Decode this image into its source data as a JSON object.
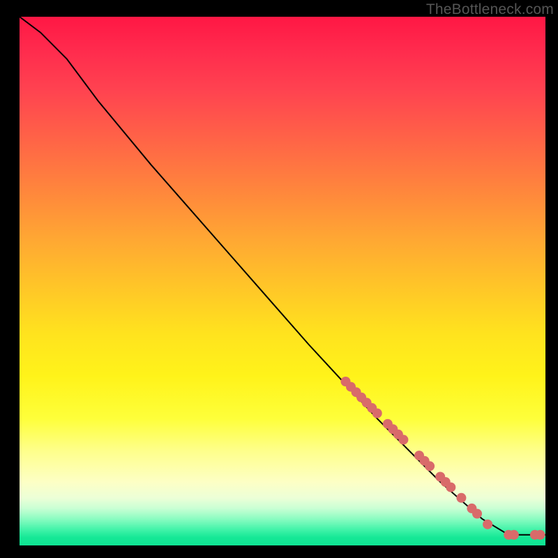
{
  "watermark": "TheBottleneck.com",
  "chart_data": {
    "type": "line",
    "title": "",
    "xlabel": "",
    "ylabel": "",
    "xlim": [
      0,
      100
    ],
    "ylim": [
      0,
      100
    ],
    "curve": [
      {
        "x": 0,
        "y": 100
      },
      {
        "x": 4,
        "y": 97
      },
      {
        "x": 9,
        "y": 92
      },
      {
        "x": 15,
        "y": 84
      },
      {
        "x": 25,
        "y": 72
      },
      {
        "x": 40,
        "y": 55
      },
      {
        "x": 55,
        "y": 38
      },
      {
        "x": 68,
        "y": 24
      },
      {
        "x": 80,
        "y": 12
      },
      {
        "x": 88,
        "y": 5
      },
      {
        "x": 93,
        "y": 2
      },
      {
        "x": 100,
        "y": 2
      }
    ],
    "markers": [
      {
        "x": 62,
        "y": 31
      },
      {
        "x": 63,
        "y": 30
      },
      {
        "x": 64,
        "y": 29
      },
      {
        "x": 65,
        "y": 28
      },
      {
        "x": 66,
        "y": 27
      },
      {
        "x": 67,
        "y": 26
      },
      {
        "x": 68,
        "y": 25
      },
      {
        "x": 70,
        "y": 23
      },
      {
        "x": 71,
        "y": 22
      },
      {
        "x": 72,
        "y": 21
      },
      {
        "x": 73,
        "y": 20
      },
      {
        "x": 76,
        "y": 17
      },
      {
        "x": 77,
        "y": 16
      },
      {
        "x": 78,
        "y": 15
      },
      {
        "x": 80,
        "y": 13
      },
      {
        "x": 81,
        "y": 12
      },
      {
        "x": 82,
        "y": 11
      },
      {
        "x": 84,
        "y": 9
      },
      {
        "x": 86,
        "y": 7
      },
      {
        "x": 87,
        "y": 6
      },
      {
        "x": 89,
        "y": 4
      },
      {
        "x": 93,
        "y": 2
      },
      {
        "x": 94,
        "y": 2
      },
      {
        "x": 98,
        "y": 2
      },
      {
        "x": 99,
        "y": 2
      }
    ],
    "gradient_stops": [
      {
        "pos": 0,
        "color": "#ff1744"
      },
      {
        "pos": 25,
        "color": "#ff6a45"
      },
      {
        "pos": 50,
        "color": "#ffc229"
      },
      {
        "pos": 75,
        "color": "#feff3a"
      },
      {
        "pos": 90,
        "color": "#fdffc5"
      },
      {
        "pos": 100,
        "color": "#0fe493"
      }
    ],
    "marker_color": "#d96a6a",
    "curve_color": "#000000"
  }
}
